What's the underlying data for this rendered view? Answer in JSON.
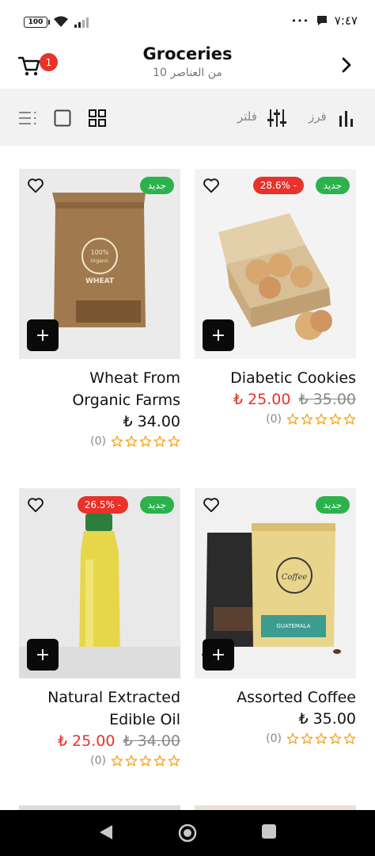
{
  "status": {
    "battery": "100",
    "time": "٧:٤٧",
    "dots": "•••"
  },
  "header": {
    "title": "Groceries",
    "subtitle": "10 من العناصر",
    "cart_count": "1"
  },
  "toolbar": {
    "sort_label": "فرز",
    "filter_label": "فلتر"
  },
  "products": [
    {
      "name_line1": "Wheat From",
      "name_line2": "Organic Farms",
      "price": "₺ 34.00",
      "old_price": "",
      "discount": "",
      "new_badge": "جديد",
      "rating_count": "(0)"
    },
    {
      "name_line1": "Diabetic Cookies",
      "name_line2": "",
      "price": "₺ 25.00",
      "old_price": "₺ 35.00",
      "discount": "28.6% -",
      "new_badge": "جديد",
      "rating_count": "(0)"
    },
    {
      "name_line1": "Natural Extracted",
      "name_line2": "Edible Oil",
      "price": "₺ 25.00",
      "old_price": "₺ 34.00",
      "discount": "26.5% -",
      "new_badge": "جديد",
      "rating_count": "(0)"
    },
    {
      "name_line1": "Assorted Coffee",
      "name_line2": "",
      "price": "₺ 35.00",
      "old_price": "",
      "discount": "",
      "new_badge": "جديد",
      "rating_count": "(0)"
    }
  ],
  "add_button_label": "+",
  "colors": {
    "accent_red": "#e8322a",
    "badge_green": "#2bb24c",
    "toolbar_bg": "#f2f2f2",
    "star": "#f5a623"
  }
}
